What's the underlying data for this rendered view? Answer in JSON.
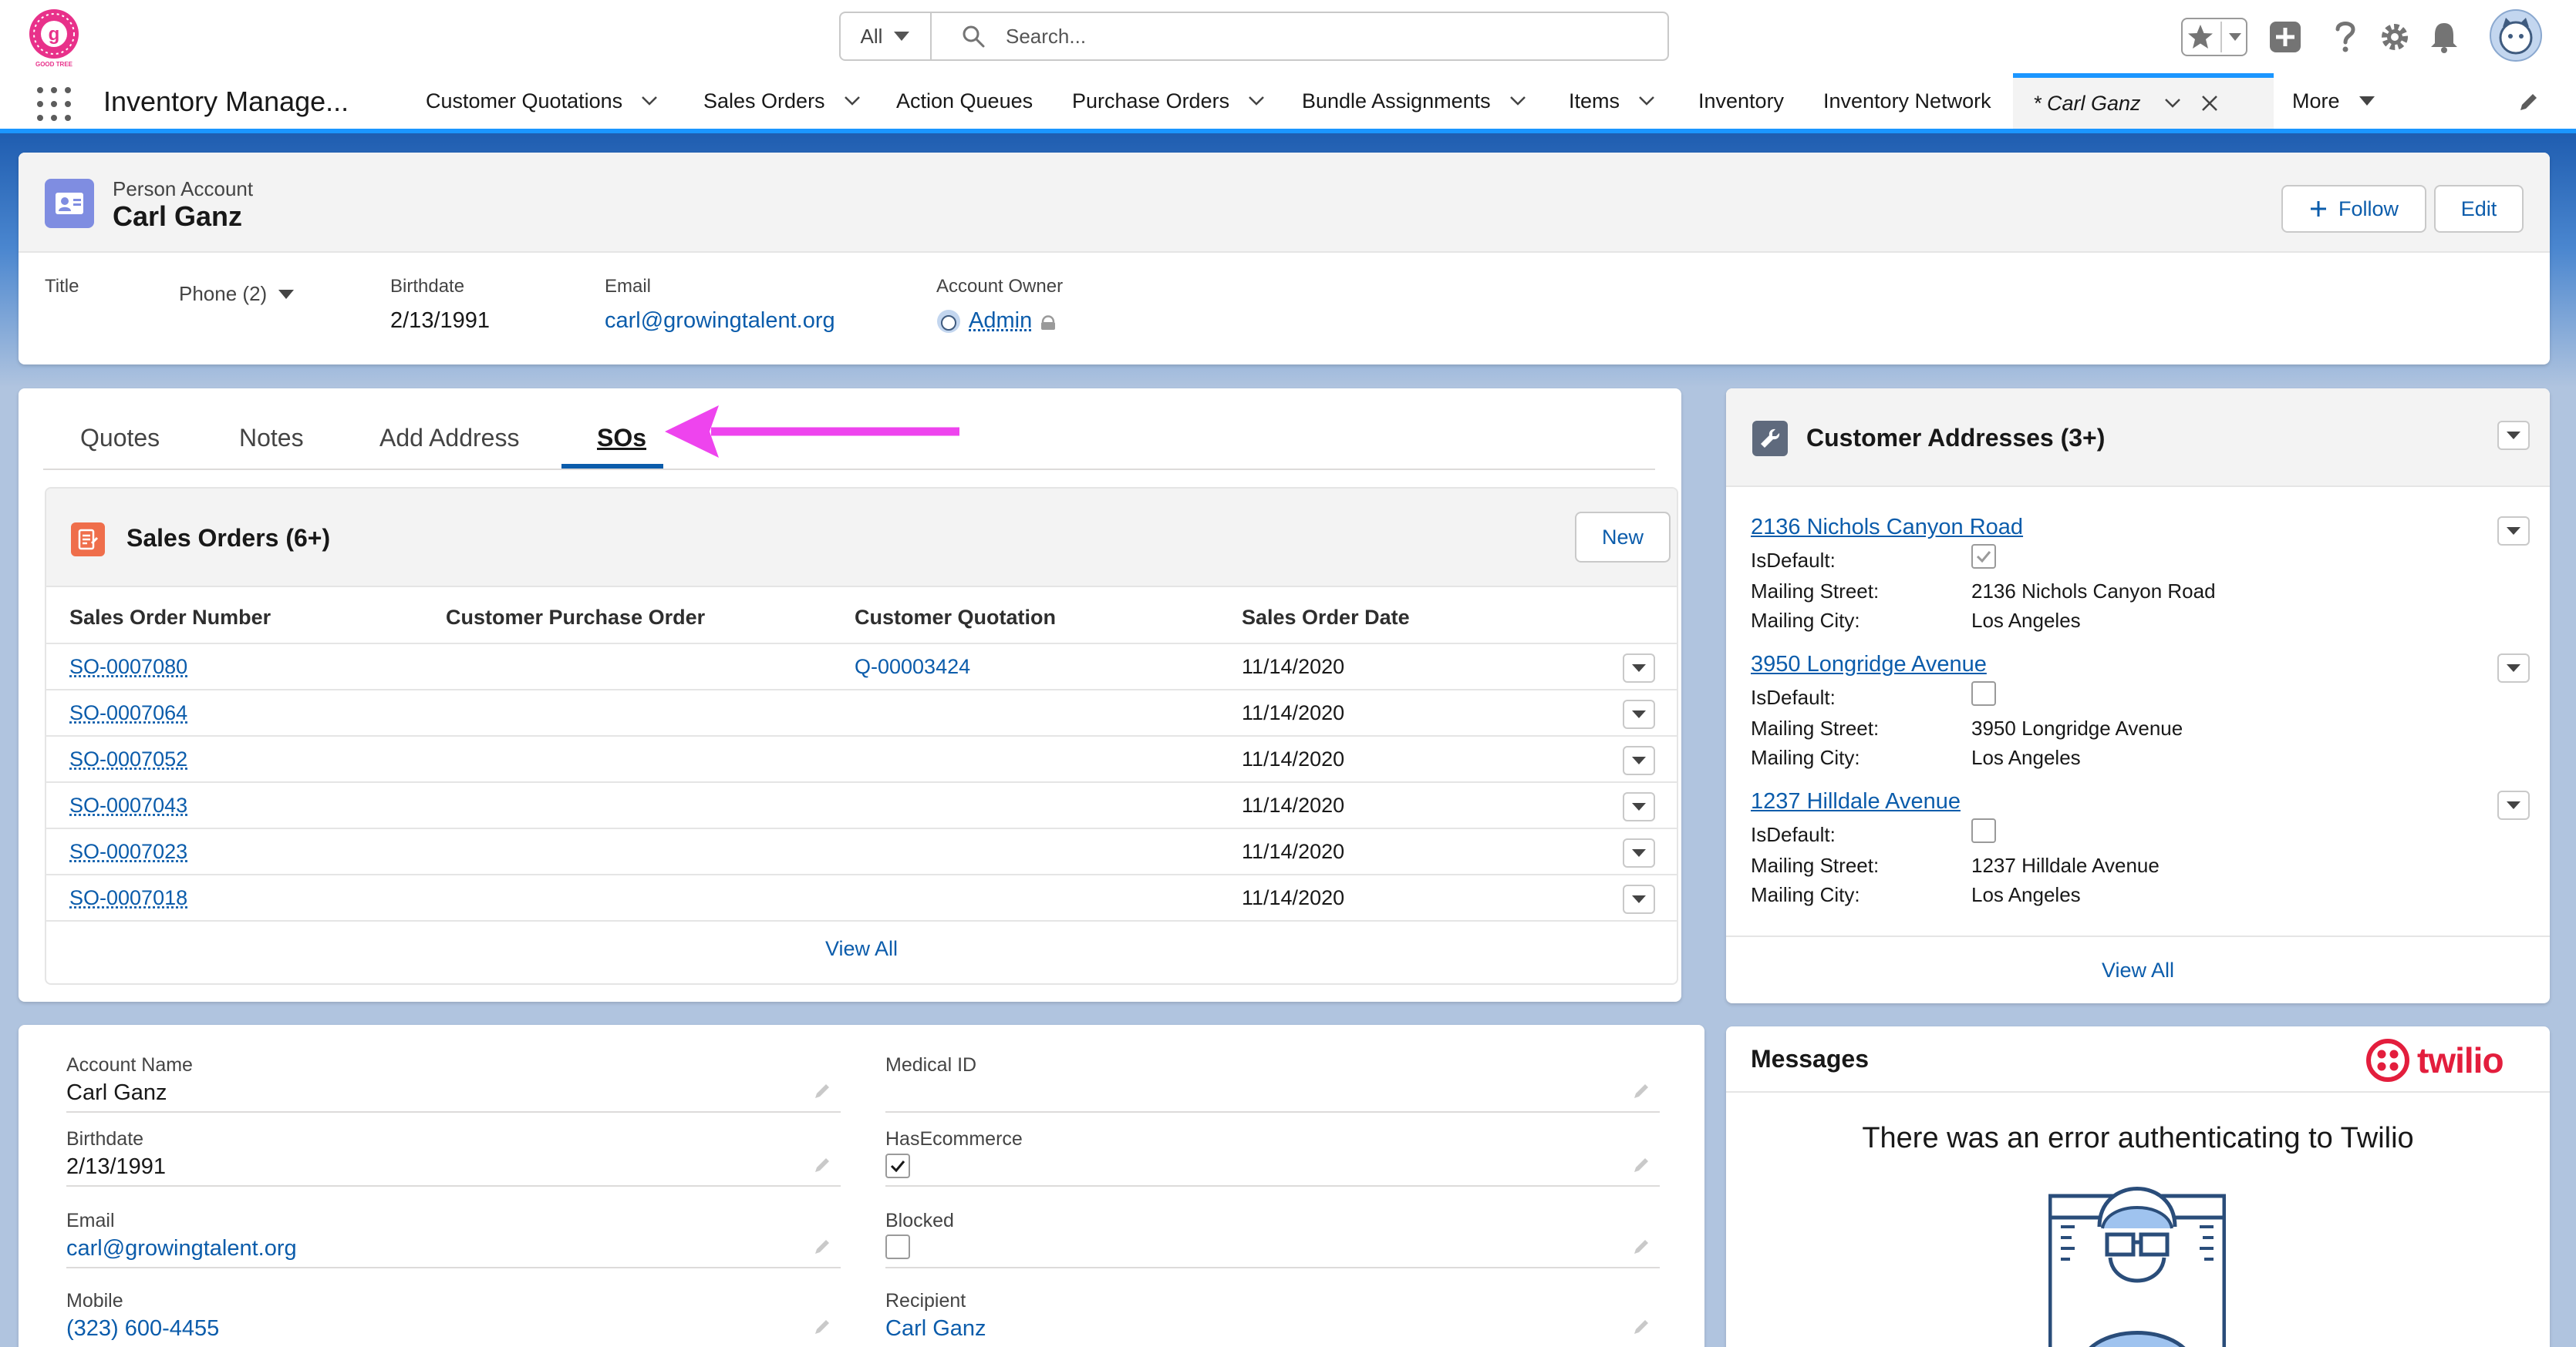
{
  "header": {
    "search": {
      "scope": "All",
      "placeholder": "Search..."
    },
    "logo_text": "GOOD TREE"
  },
  "nav": {
    "app_name": "Inventory Manage...",
    "items": [
      {
        "label": "Customer Quotations",
        "dropdown": true
      },
      {
        "label": "Sales Orders",
        "dropdown": true
      },
      {
        "label": "Action Queues",
        "dropdown": false
      },
      {
        "label": "Purchase Orders",
        "dropdown": true
      },
      {
        "label": "Bundle Assignments",
        "dropdown": true
      },
      {
        "label": "Items",
        "dropdown": true
      },
      {
        "label": "Inventory",
        "dropdown": false
      },
      {
        "label": "Inventory Network",
        "dropdown": false
      }
    ],
    "active_tab": "* Carl Ganz",
    "more_label": "More"
  },
  "record": {
    "type": "Person Account",
    "name": "Carl Ganz",
    "follow_label": "Follow",
    "edit_label": "Edit",
    "highlights": {
      "title_label": "Title",
      "phone_label": "Phone (2)",
      "birthdate_label": "Birthdate",
      "birthdate": "2/13/1991",
      "email_label": "Email",
      "email": "carl@growingtalent.org",
      "owner_label": "Account Owner",
      "owner": "Admin"
    }
  },
  "tabs": [
    "Quotes",
    "Notes",
    "Add Address",
    "SOs"
  ],
  "sales_orders": {
    "title": "Sales Orders (6+)",
    "new_label": "New",
    "columns": [
      "Sales Order Number",
      "Customer Purchase Order",
      "Customer Quotation",
      "Sales Order Date"
    ],
    "rows": [
      {
        "number": "SO-0007080",
        "po": "",
        "quotation": "Q-00003424",
        "date": "11/14/2020"
      },
      {
        "number": "SO-0007064",
        "po": "",
        "quotation": "",
        "date": "11/14/2020"
      },
      {
        "number": "SO-0007052",
        "po": "",
        "quotation": "",
        "date": "11/14/2020"
      },
      {
        "number": "SO-0007043",
        "po": "",
        "quotation": "",
        "date": "11/14/2020"
      },
      {
        "number": "SO-0007023",
        "po": "",
        "quotation": "",
        "date": "11/14/2020"
      },
      {
        "number": "SO-0007018",
        "po": "",
        "quotation": "",
        "date": "11/14/2020"
      }
    ],
    "view_all": "View All"
  },
  "addresses": {
    "title": "Customer Addresses (3+)",
    "labels": {
      "default": "IsDefault:",
      "street": "Mailing Street:",
      "city": "Mailing City:"
    },
    "items": [
      {
        "name": "2136 Nichols Canyon Road",
        "is_default": true,
        "street": "2136 Nichols Canyon Road",
        "city": "Los Angeles"
      },
      {
        "name": "3950 Longridge Avenue",
        "is_default": false,
        "street": "3950 Longridge Avenue",
        "city": "Los Angeles"
      },
      {
        "name": "1237 Hilldale Avenue",
        "is_default": false,
        "street": "1237 Hilldale Avenue",
        "city": "Los Angeles"
      }
    ],
    "view_all": "View All"
  },
  "details": {
    "left": [
      {
        "label": "Account Name",
        "value": "Carl Ganz",
        "link": false
      },
      {
        "label": "Birthdate",
        "value": "2/13/1991",
        "link": false
      },
      {
        "label": "Email",
        "value": "carl@growingtalent.org",
        "link": true
      },
      {
        "label": "Mobile",
        "value": "(323) 600-4455",
        "link": true
      }
    ],
    "right": [
      {
        "label": "Medical ID",
        "value": ""
      },
      {
        "label": "HasEcommerce",
        "checked": true
      },
      {
        "label": "Blocked",
        "checked": false
      },
      {
        "label": "Recipient",
        "value": "Carl Ganz"
      }
    ]
  },
  "messages": {
    "title": "Messages",
    "brand": "twilio",
    "error": "There was an error authenticating to Twilio"
  },
  "colors": {
    "brand_blue": "#0b5cab",
    "nav_accent": "#1b96ff",
    "annotation_arrow": "#ee44ee",
    "twilio_red": "#e31e3d",
    "account_icon": "#7f8de1",
    "sales_order_icon": "#ef6e4b"
  }
}
